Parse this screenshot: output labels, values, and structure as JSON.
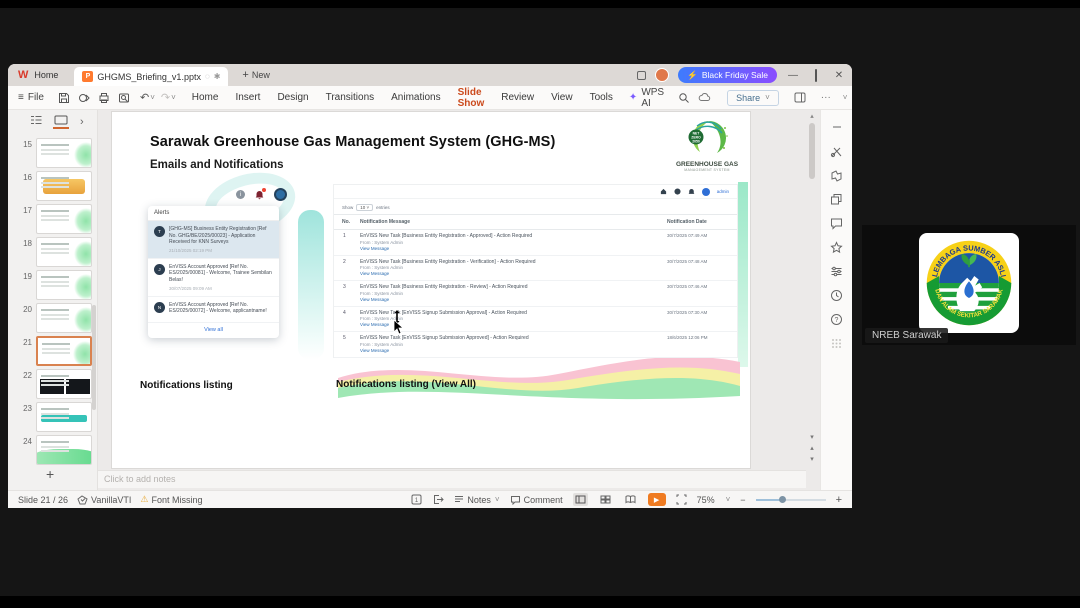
{
  "titlebar": {
    "home_tab": "Home",
    "doc_tab": "GHGMS_Briefing_v1.pptx",
    "new_label": "New",
    "promo": "Black Friday Sale"
  },
  "menubar": {
    "file": "File",
    "items": [
      {
        "label": "Home"
      },
      {
        "label": "Insert"
      },
      {
        "label": "Design"
      },
      {
        "label": "Transitions"
      },
      {
        "label": "Animations"
      },
      {
        "label": "Slide Show",
        "variant": "active"
      },
      {
        "label": "Review"
      },
      {
        "label": "View"
      },
      {
        "label": "Tools"
      }
    ],
    "wps_ai": "WPS AI",
    "share": "Share"
  },
  "thumbnails": [
    {
      "num": "15",
      "variant": "plain"
    },
    {
      "num": "16",
      "variant": "yellow"
    },
    {
      "num": "17",
      "variant": "plain"
    },
    {
      "num": "18",
      "variant": "plain"
    },
    {
      "num": "19",
      "variant": "plain"
    },
    {
      "num": "20",
      "variant": "plain"
    },
    {
      "num": "21",
      "variant": "selected"
    },
    {
      "num": "22",
      "variant": "dark"
    },
    {
      "num": "23",
      "variant": "teal"
    },
    {
      "num": "24",
      "variant": "green"
    }
  ],
  "slide": {
    "title": "Sarawak Greenhouse Gas Management System (GHG-MS)",
    "subtitle": "Emails and Notifications",
    "logo": {
      "line1": "GREENHOUSE GAS",
      "line2": "MANAGEMENT SYSTEM",
      "badge": "NET ZERO 2050"
    },
    "alerts": {
      "header": "Alerts",
      "view_all": "View all",
      "items": [
        {
          "initial": "T",
          "text": "[GHG-MS] Business Entity Registration [Ref No. GHG/BE/2025/00023] - Application Received for KNN Surveys",
          "date": "21/10/2025 02:19 PM",
          "variant": "unread"
        },
        {
          "initial": "J",
          "text": "EnVISS Account Approved [Ref No. ES/2025/00081] - Welcome, Trainee Sembilan Belas!",
          "date": "30/07/2025 09:09 AM"
        },
        {
          "initial": "N",
          "text": "EnVISS Account Approved [Ref No. ES/2025/00072] - Welcome, applicantname!",
          "date": ""
        }
      ]
    },
    "portal": {
      "admin": "admin",
      "show": "Show",
      "page_size": "10",
      "entries": "entries",
      "columns": [
        "No.",
        "Notification Message",
        "Notification Date"
      ],
      "rows": [
        {
          "no": "1",
          "message": "EnVISS New Task [Business Entity Registration - Approved] - Action Required",
          "from": "From : System Admin",
          "link": "View Message",
          "date": "30/7/2025 07:49 AM"
        },
        {
          "no": "2",
          "message": "EnVISS New Task [Business Entity Registration - Verification] - Action Required",
          "from": "From : System Admin",
          "link": "View Message",
          "date": "30/7/2025 07:48 AM"
        },
        {
          "no": "3",
          "message": "EnVISS New Task [Business Entity Registration - Review] - Action Required",
          "from": "From : System Admin",
          "link": "View Message",
          "date": "30/7/2025 07:46 AM"
        },
        {
          "no": "4",
          "message": "EnVISS New Task [EnVISS Signup Submission Approval] - Action Required",
          "from": "From : System Admin",
          "link": "View Message",
          "date": "30/7/2025 07:30 AM"
        },
        {
          "no": "5",
          "message": "EnVISS New Task [EnVISS Signup Submission Approved] - Action Required",
          "from": "From : System Admin",
          "link": "View Message",
          "date": "18/6/2025 12:06 PM"
        }
      ]
    },
    "captions": {
      "left": "Notifications listing",
      "right": "Notifications listing (View All)"
    }
  },
  "notes_placeholder": "Click to add notes",
  "statusbar": {
    "slide_indicator": "Slide 21 / 26",
    "theme": "VanillaVTI",
    "font_missing": "Font Missing",
    "notes": "Notes",
    "comment": "Comment",
    "zoom": "75%"
  },
  "participant": {
    "name": "NREB Sarawak",
    "logo_arc_top": "LEMBAGA SUMBER ASLI",
    "logo_arc_bottom": "DAN ALAM SEKITAR SARAWAK"
  },
  "icons": {
    "wps_logo": "W",
    "p_badge": "P",
    "sync": "◌",
    "modified": "✱",
    "plus": "+",
    "bolt": "⚡",
    "minimize": "—",
    "close": "✕",
    "menu": "≡",
    "undo": "↶",
    "redo": "↷",
    "caret_down": "˅",
    "chevron_right": "›",
    "ellipsis": "···",
    "sparkle": "✦",
    "warning": "⚠",
    "play": "▶",
    "info": "i",
    "bell": "🔔",
    "scroll_up": "▴",
    "scroll_down": "▾",
    "minus": "−",
    "add": "+"
  },
  "colors": {
    "accent_orange": "#cb4a1d",
    "promo_gradient_start": "#3e7bfd",
    "promo_gradient_end": "#8a4dff",
    "play_orange": "#ef7b21",
    "link_blue": "#2b6cb0",
    "unread_bg": "#dce7ef",
    "logo_yellow": "#f7d117",
    "logo_green": "#169b33",
    "logo_blue": "#1d56a5"
  }
}
